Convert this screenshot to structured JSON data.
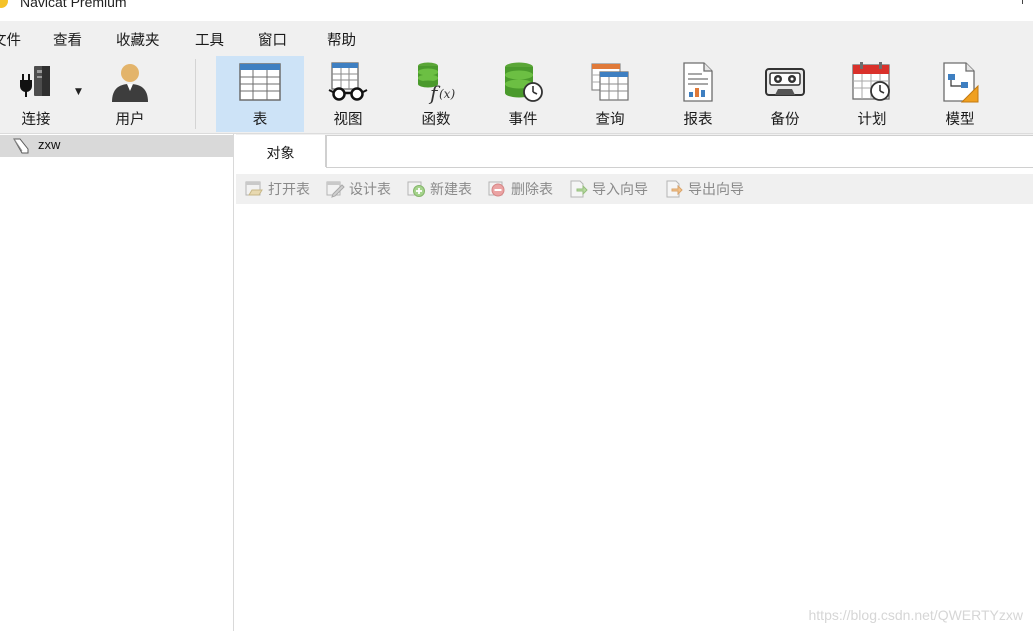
{
  "window": {
    "title": "Navicat Premium"
  },
  "menubar": {
    "items": [
      "文件",
      "查看",
      "收藏夹",
      "工具",
      "窗口",
      "帮助"
    ]
  },
  "toolbar": {
    "tools": [
      {
        "label": "连接",
        "icon": "connection-icon"
      },
      {
        "label": "用户",
        "icon": "user-icon"
      },
      {
        "label": "表",
        "icon": "table-icon",
        "active": true
      },
      {
        "label": "视图",
        "icon": "view-icon"
      },
      {
        "label": "函数",
        "icon": "function-icon"
      },
      {
        "label": "事件",
        "icon": "event-icon"
      },
      {
        "label": "查询",
        "icon": "query-icon"
      },
      {
        "label": "报表",
        "icon": "report-icon"
      },
      {
        "label": "备份",
        "icon": "backup-icon"
      },
      {
        "label": "计划",
        "icon": "schedule-icon"
      },
      {
        "label": "模型",
        "icon": "model-icon"
      }
    ]
  },
  "sidebar": {
    "connections": [
      {
        "label": "zxw",
        "icon": "connection-node-icon"
      }
    ]
  },
  "main": {
    "tab": {
      "label": "对象"
    },
    "actions": [
      {
        "label": "打开表",
        "icon": "open-table-icon"
      },
      {
        "label": "设计表",
        "icon": "design-table-icon"
      },
      {
        "label": "新建表",
        "icon": "new-table-icon"
      },
      {
        "label": "删除表",
        "icon": "delete-table-icon"
      },
      {
        "label": "导入向导",
        "icon": "import-wizard-icon"
      },
      {
        "label": "导出向导",
        "icon": "export-wizard-icon"
      }
    ]
  },
  "watermark": "https://blog.csdn.net/QWERTYzxw",
  "colors": {
    "active_tool_bg": "#cde3f7",
    "chrome_bg": "#f0f0f0",
    "sidebar_selected_bg": "#d9d9d9"
  }
}
